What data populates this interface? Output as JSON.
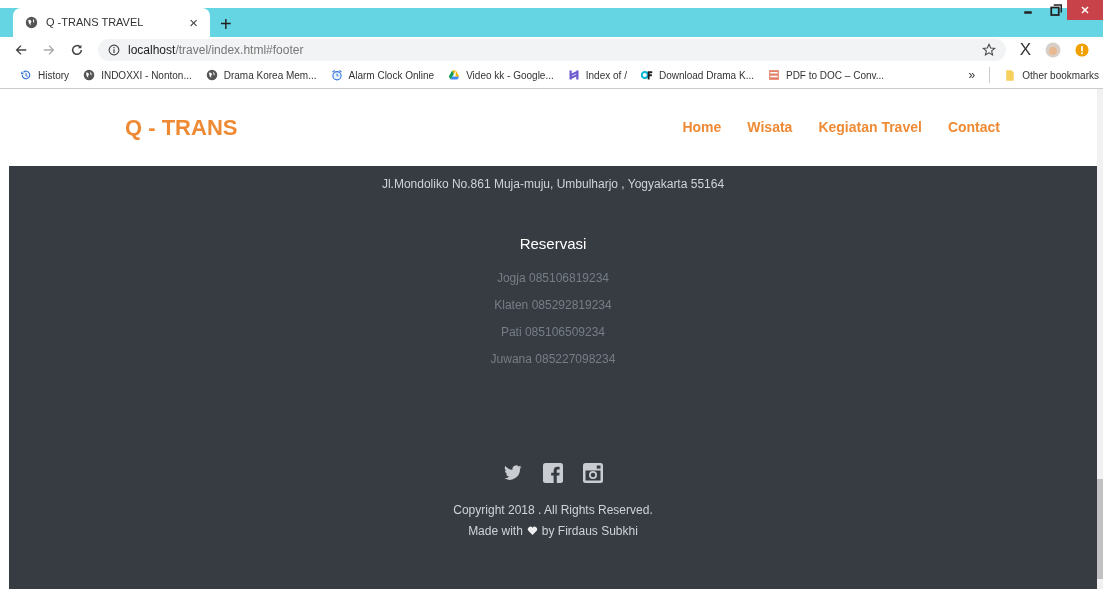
{
  "browser": {
    "tab_title": "Q -TRANS TRAVEL",
    "tab_close": "×",
    "new_tab": "+",
    "url_host": "localhost",
    "url_path": "/travel/index.html#footer",
    "bookmarks": [
      {
        "kind": "history",
        "label": "History"
      },
      {
        "kind": "globe",
        "label": "INDOXXI - Nonton..."
      },
      {
        "kind": "globe",
        "label": "Drama Korea Mem..."
      },
      {
        "kind": "alarm",
        "label": "Alarm Clock Online"
      },
      {
        "kind": "drive",
        "label": "Video kk - Google..."
      },
      {
        "kind": "index",
        "label": "Index of /"
      },
      {
        "kind": "df",
        "label": "Download Drama K..."
      },
      {
        "kind": "pdf",
        "label": "PDF to DOC – Conv..."
      }
    ],
    "more": "»",
    "other_bookmarks": "Other bookmarks",
    "extension": "X"
  },
  "navbar": {
    "brand": "Q - TRANS",
    "links": [
      "Home",
      "Wisata",
      "Kegiatan Travel",
      "Contact"
    ]
  },
  "footer": {
    "address": "Jl.Mondoliko No.861 Muja-muju, Umbulharjo , Yogyakarta 55164",
    "heading": "Reservasi",
    "contacts": [
      "Jogja 085106819234",
      "Klaten 085292819234",
      "Pati 085106509234",
      "Juwana 085227098234"
    ],
    "copyright": "Copyright 2018 . All Rights Reserved.",
    "made_with": "Made with",
    "by": "by Firdaus Subkhi"
  }
}
